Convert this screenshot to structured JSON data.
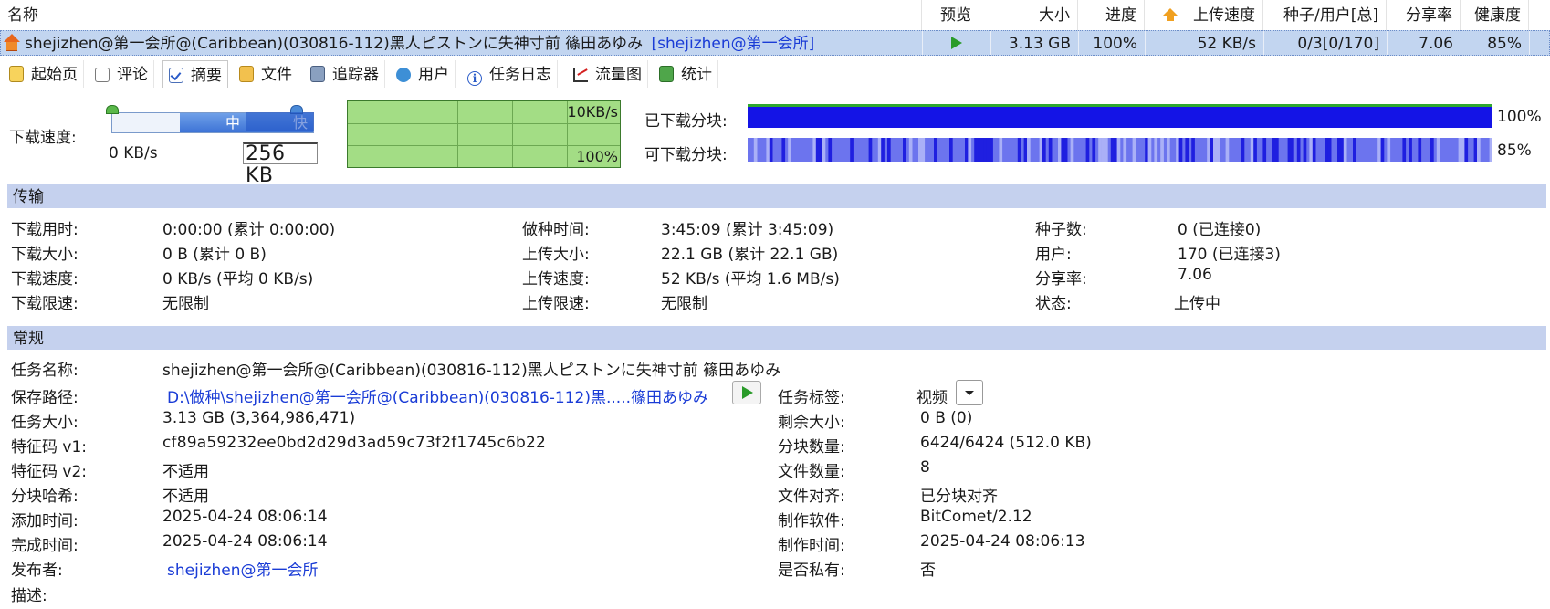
{
  "columns": {
    "name": "名称",
    "preview": "预览",
    "size": "大小",
    "progress": "进度",
    "upload_speed": "上传速度",
    "seeds_peers": "种子/用户[总]",
    "ratio": "分享率",
    "health": "健康度"
  },
  "torrent": {
    "name": "shejizhen@第一会所@(Caribbean)(030816-112)黑人ピストンに失神寸前 篠田あゆみ",
    "name_tag": "[shejizhen@第一会所]",
    "size": "3.13 GB",
    "progress": "100%",
    "upload_speed": "52 KB/s",
    "seeds_peers": "0/3[0/170]",
    "ratio": "7.06",
    "health": "85%"
  },
  "tabs": [
    "起始页",
    "评论",
    "摘要",
    "文件",
    "追踪器",
    "用户",
    "任务日志",
    "流量图",
    "统计"
  ],
  "speed": {
    "label": "下载速度:",
    "current": "0 KB/s",
    "limit_value": "256 KB",
    "slider_mid": "中",
    "slider_fast": "快",
    "graph_top": "10KB/s",
    "graph_bottom": "100%"
  },
  "pieces": {
    "downloaded_label": "已下载分块:",
    "downloaded_pct": "100%",
    "available_label": "可下载分块:",
    "available_pct": "85%",
    "downloaded_fraction": 1.0,
    "available_fraction": 0.85
  },
  "transfer": {
    "title": "传输",
    "col1": [
      {
        "label": "下载用时:",
        "value": "0:00:00 (累计 0:00:00)"
      },
      {
        "label": "下载大小:",
        "value": "0 B (累计 0 B)"
      },
      {
        "label": "下载速度:",
        "value": "0 KB/s (平均 0 KB/s)"
      },
      {
        "label": "下载限速:",
        "value": "无限制"
      }
    ],
    "col2": [
      {
        "label": "做种时间:",
        "value": "3:45:09 (累计 3:45:09)"
      },
      {
        "label": "上传大小:",
        "value": "22.1 GB (累计 22.1 GB)"
      },
      {
        "label": "上传速度:",
        "value": "52 KB/s (平均 1.6 MB/s)"
      },
      {
        "label": "上传限速:",
        "value": "无限制"
      }
    ],
    "col3": [
      {
        "label": "种子数:",
        "value": "0 (已连接0)"
      },
      {
        "label": "用户:",
        "value": "170 (已连接3)"
      },
      {
        "label": "分享率:",
        "value": "7.06"
      },
      {
        "label": "状态:",
        "value": "上传中"
      }
    ]
  },
  "general": {
    "title": "常规",
    "task_name_label": "任务名称:",
    "task_name": "shejizhen@第一会所@(Caribbean)(030816-112)黑人ピストンに失神寸前 篠田あゆみ",
    "save_path_label": "保存路径:",
    "save_path": "D:\\做种\\shejizhen@第一会所@(Caribbean)(030816-112)黒.....篠田あゆみ",
    "task_tag_label": "任务标签:",
    "task_tag": "视频",
    "left": [
      {
        "label": "任务大小:",
        "value": "3.13 GB (3,364,986,471)"
      },
      {
        "label": "特征码 v1:",
        "value": "cf89a59232ee0bd2d29d3ad59c73f2f1745c6b22"
      },
      {
        "label": "特征码 v2:",
        "value": "不适用"
      },
      {
        "label": "分块哈希:",
        "value": "不适用"
      },
      {
        "label": "添加时间:",
        "value": "2025-04-24 08:06:14"
      },
      {
        "label": "完成时间:",
        "value": "2025-04-24 08:06:14"
      },
      {
        "label": "发布者:",
        "value": "shejizhen@第一会所"
      },
      {
        "label": "描述:",
        "value": ""
      }
    ],
    "right": [
      {
        "label": "剩余大小:",
        "value": "0 B (0)"
      },
      {
        "label": "分块数量:",
        "value": "6424/6424 (512.0 KB)"
      },
      {
        "label": "文件数量:",
        "value": "8"
      },
      {
        "label": "文件对齐:",
        "value": "已分块对齐"
      },
      {
        "label": "制作软件:",
        "value": "BitComet/2.12"
      },
      {
        "label": "制作时间:",
        "value": "2025-04-24 08:06:13"
      },
      {
        "label": "是否私有:",
        "value": "否"
      }
    ]
  },
  "colors": {
    "selected_row": "#c2d5f0",
    "section_bg": "#c5d1ee",
    "piece_blue": "#1414e6",
    "graph_green": "#a3dd85",
    "link": "#1a3cd6"
  }
}
